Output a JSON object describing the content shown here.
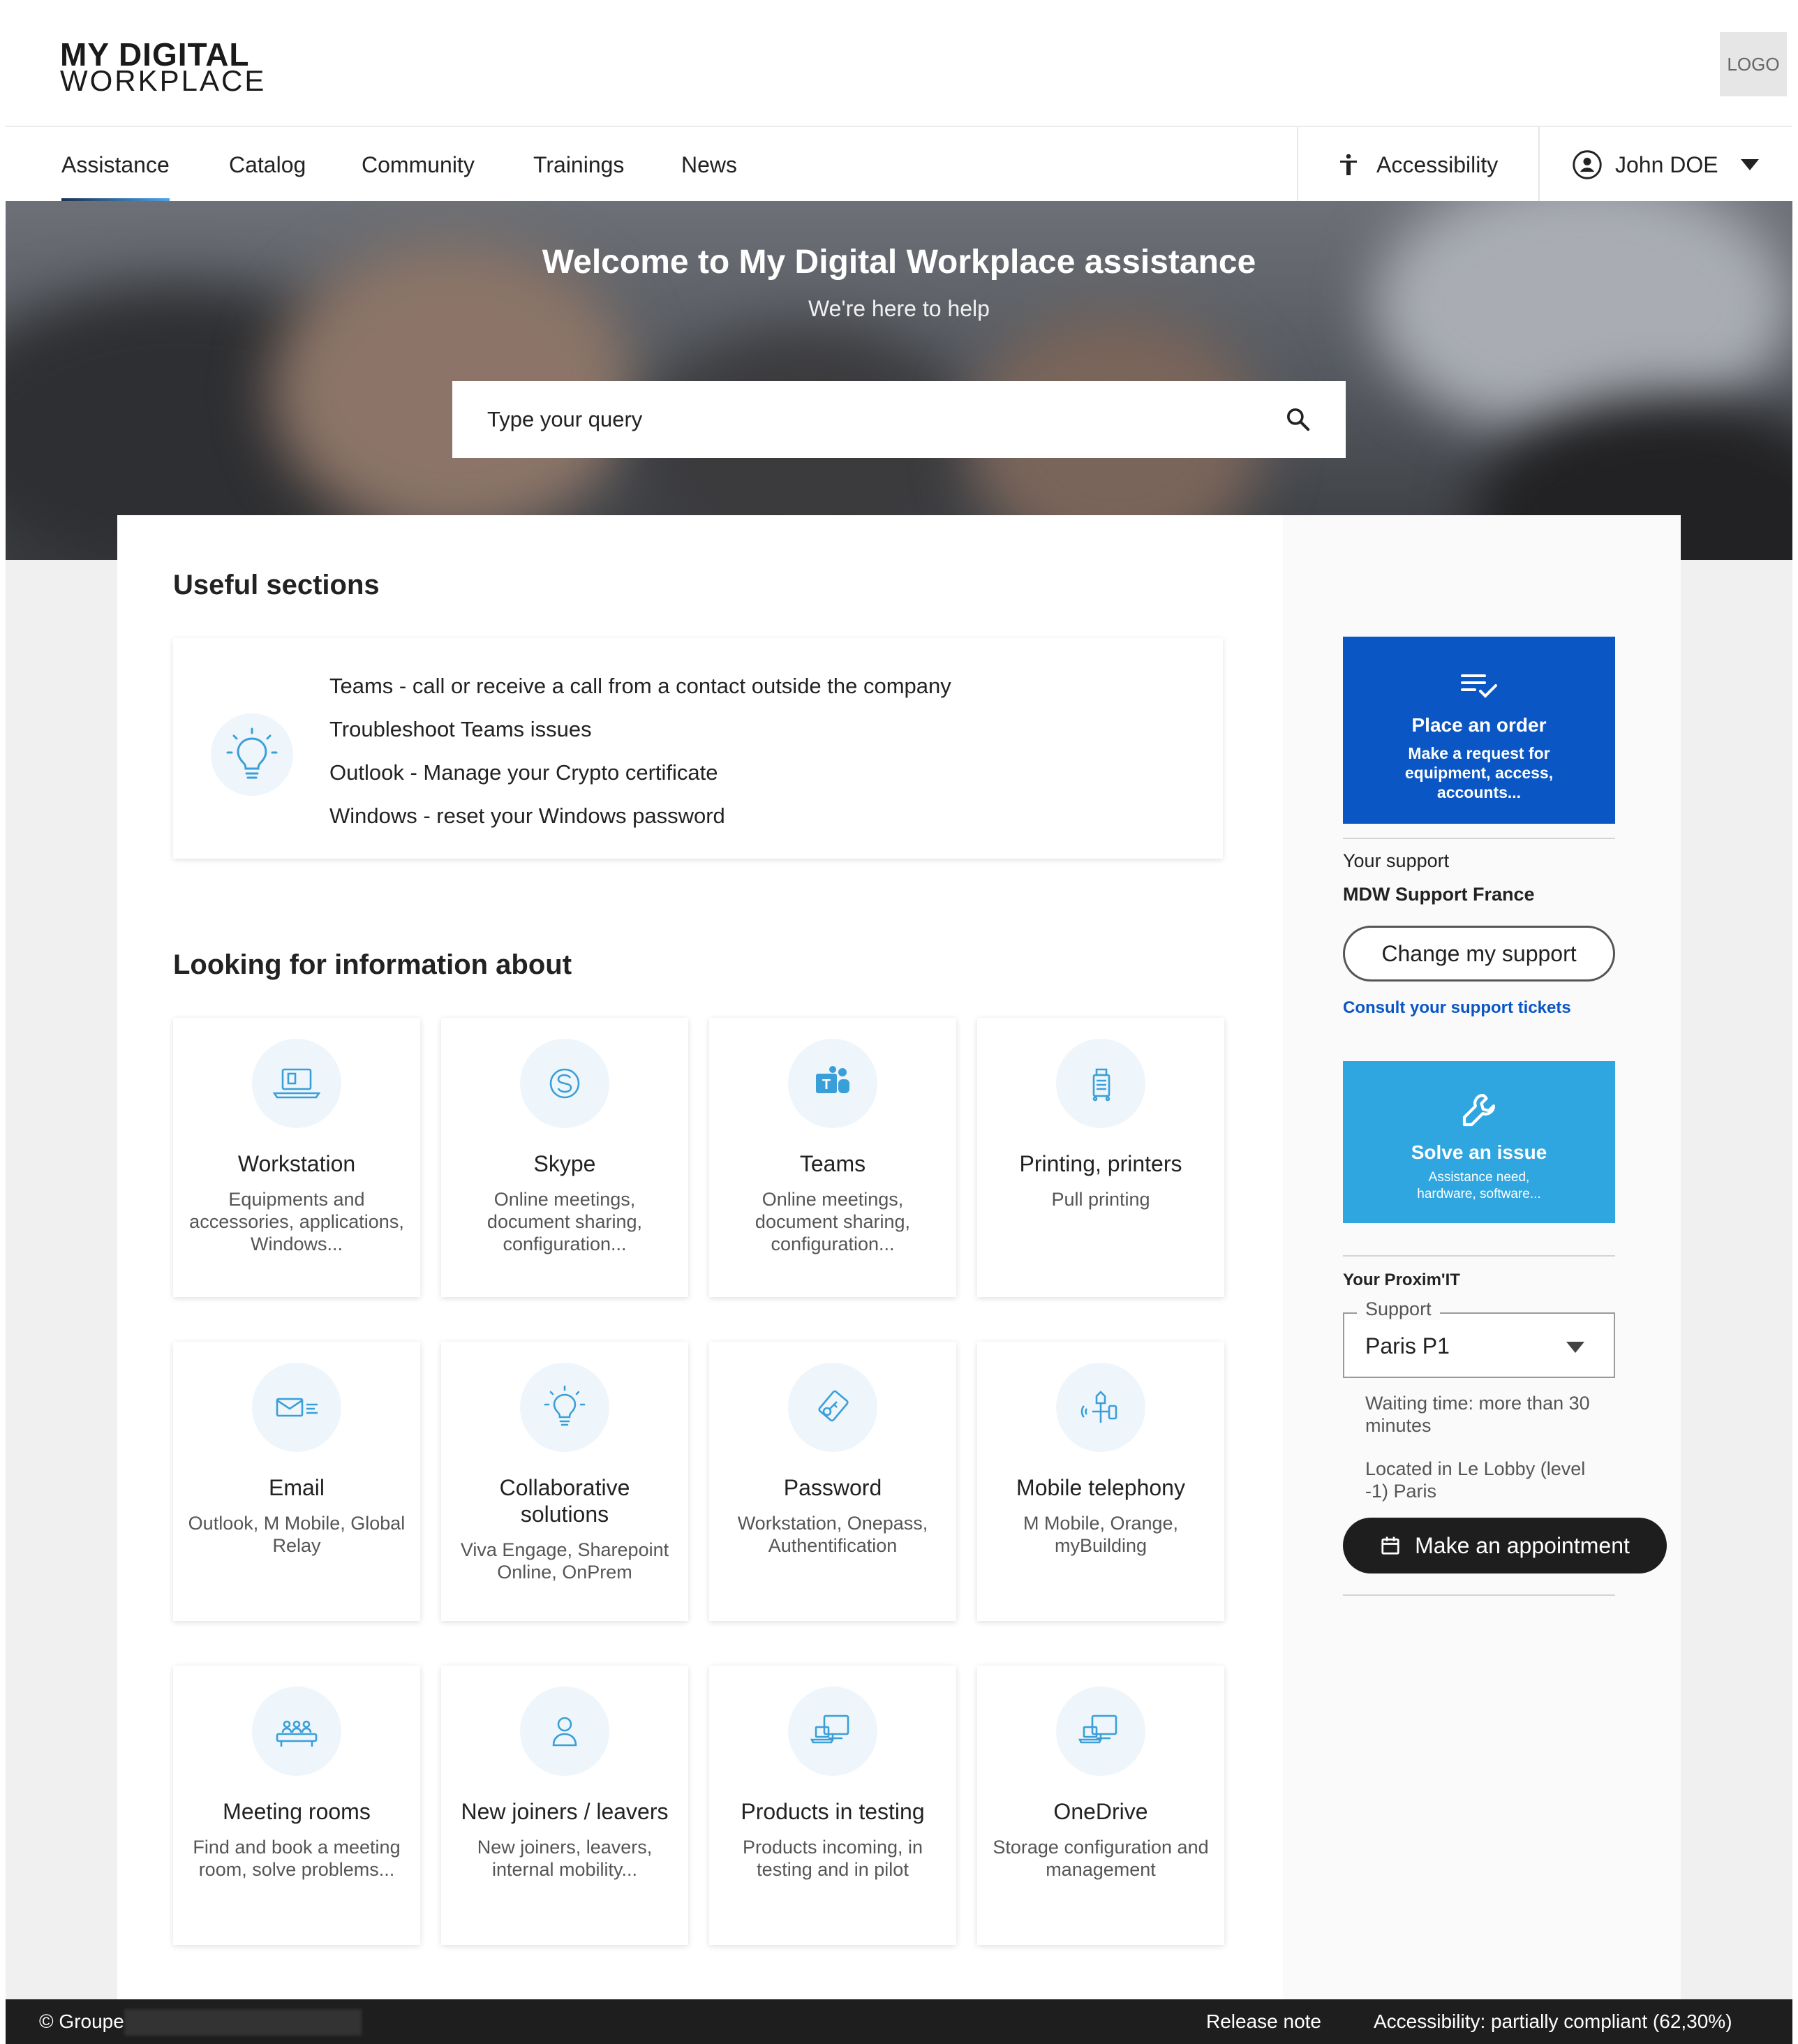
{
  "brand": {
    "line1": "MY DIGITAL",
    "line2": "WORKPLACE",
    "logo_label": "LOGO"
  },
  "nav": {
    "items": [
      {
        "label": "Assistance",
        "active": true
      },
      {
        "label": "Catalog"
      },
      {
        "label": "Community"
      },
      {
        "label": "Trainings"
      },
      {
        "label": "News"
      }
    ],
    "accessibility_label": "Accessibility",
    "user_name": "John DOE"
  },
  "hero": {
    "title": "Welcome to My Digital Workplace assistance",
    "subtitle": "We're here to help",
    "search_placeholder": "Type your query"
  },
  "useful_sections": {
    "title": "Useful sections",
    "links": [
      "Teams - call or receive a call from a contact outside the company",
      "Troubleshoot Teams issues",
      "Outlook - Manage your Crypto certificate",
      "Windows - reset your Windows password"
    ]
  },
  "looking_for": {
    "title": "Looking for information about",
    "tiles": [
      {
        "icon": "laptop-icon",
        "title": "Workstation",
        "desc": "Equipments and accessories, applications, Windows..."
      },
      {
        "icon": "skype-icon",
        "title": "Skype",
        "desc": "Online meetings, document sharing, configuration..."
      },
      {
        "icon": "teams-icon",
        "title": "Teams",
        "desc": "Online meetings, document sharing, configuration..."
      },
      {
        "icon": "printer-icon",
        "title": "Printing, printers",
        "desc": "Pull printing"
      },
      {
        "icon": "email-icon",
        "title": "Email",
        "desc": "Outlook, M Mobile, Global Relay"
      },
      {
        "icon": "bulb-icon",
        "title": "Collaborative solutions",
        "desc": "Viva Engage, Sharepoint Online, OnPrem"
      },
      {
        "icon": "password-icon",
        "title": "Password",
        "desc": "Workstation, Onepass, Authentification"
      },
      {
        "icon": "mobile-icon",
        "title": "Mobile telephony",
        "desc": "M Mobile, Orange, myBuilding"
      },
      {
        "icon": "meeting-room-icon",
        "title": "Meeting rooms",
        "desc": "Find and book a meeting room, solve problems..."
      },
      {
        "icon": "user-icon",
        "title": "New joiners / leavers",
        "desc": "New joiners, leavers, internal mobility..."
      },
      {
        "icon": "products-icon",
        "title": "Products in testing",
        "desc": "Products incoming, in testing and in pilot"
      },
      {
        "icon": "onedrive-icon",
        "title": "OneDrive",
        "desc": "Storage configuration and management"
      }
    ]
  },
  "sidebar": {
    "order": {
      "title": "Place an order",
      "desc": "Make a request for equipment, access, accounts..."
    },
    "your_support_label": "Your support",
    "support_name": "MDW Support France",
    "change_support_label": "Change my support",
    "tickets_link": "Consult your support tickets",
    "solve": {
      "title": "Solve an issue",
      "desc": "Assistance need, hardware, software..."
    },
    "proximit_label": "Your Proxim'IT",
    "support_select": {
      "legend": "Support",
      "value": "Paris P1"
    },
    "waiting_time": "Waiting time: more than 30 minutes",
    "location": "Located in Le Lobby (level -1)  Paris",
    "appointment_label": "Make an appointment"
  },
  "footer": {
    "copyright": "© Groupe",
    "release_note": "Release note",
    "accessibility": "Accessibility: partially compliant (62,30%)"
  },
  "colors": {
    "primary": "#0a56c4",
    "secondary": "#30a6e0",
    "dark": "#1e1e1e",
    "icon": "#3a9fd8"
  }
}
